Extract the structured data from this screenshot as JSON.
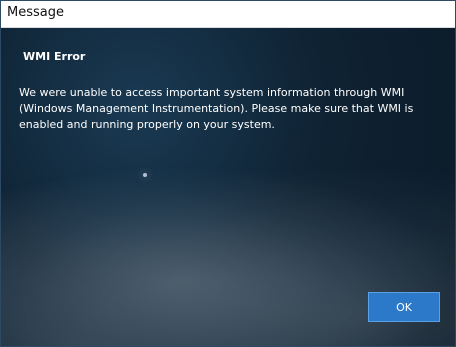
{
  "window": {
    "title": "Message"
  },
  "dialog": {
    "heading": "WMI Error",
    "message": "We were unable to access important system information through WMI (Windows Management Instrumentation).  Please make sure that WMI is enabled and running properly on your system.",
    "buttons": {
      "ok_label": "OK"
    }
  },
  "colors": {
    "titlebar_bg": "#ffffff",
    "dialog_bg": "#0f2030",
    "button_bg": "#2c78c9",
    "text": "#ffffff"
  }
}
